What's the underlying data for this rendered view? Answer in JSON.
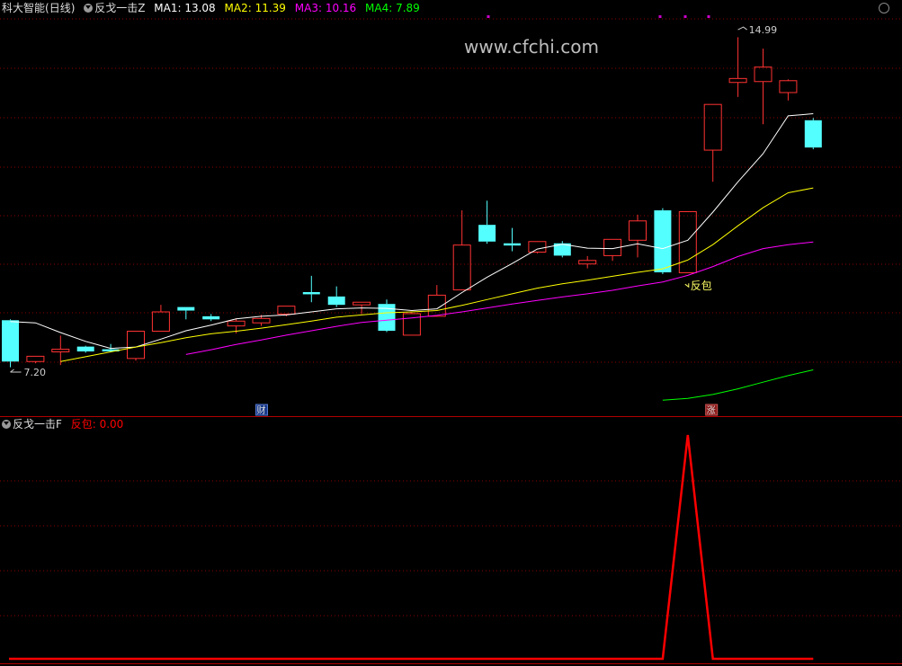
{
  "main_panel": {
    "stock_name": "科大智能",
    "period": "(日线)",
    "indicator_name": "反戈一击Z",
    "ma": [
      {
        "label": "MA1: 13.08",
        "color": "#ffffff"
      },
      {
        "label": "MA2: 11.39",
        "color": "#ffff00"
      },
      {
        "label": "MA3: 10.16",
        "color": "#ff00ff"
      },
      {
        "label": "MA4: 7.89",
        "color": "#00ff00"
      }
    ],
    "watermark": "www.cfchi.com",
    "high_label": "14.99",
    "low_label": "7.20",
    "signal_label": "反包",
    "marker_cai": "财",
    "marker_zhang": "涨"
  },
  "sub_panel": {
    "indicator_name": "反戈一击F",
    "value_label": "反包: 0.00"
  },
  "colors": {
    "up": "#ff3232",
    "down": "#54ffff",
    "ma1": "#ffffff",
    "ma2": "#ffff00",
    "ma3": "#ff00ff",
    "ma4": "#00ff00",
    "signal": "#ff0000",
    "grid": "#8b0000"
  },
  "chart_data": [
    {
      "type": "candlestick",
      "title": "科大智能 (日线)",
      "ylim": [
        6.3,
        15.5
      ],
      "candles": [
        {
          "o": 8.38,
          "h": 8.4,
          "l": 7.31,
          "c": 7.44
        },
        {
          "o": 7.44,
          "h": 7.56,
          "l": 7.4,
          "c": 7.56
        },
        {
          "o": 7.66,
          "h": 8.03,
          "l": 7.36,
          "c": 7.72
        },
        {
          "o": 7.78,
          "h": 7.8,
          "l": 7.64,
          "c": 7.67
        },
        {
          "o": 7.72,
          "h": 7.84,
          "l": 7.67,
          "c": 7.67
        },
        {
          "o": 7.51,
          "h": 8.12,
          "l": 7.46,
          "c": 8.13
        },
        {
          "o": 8.13,
          "h": 8.73,
          "l": 8.13,
          "c": 8.57
        },
        {
          "o": 8.68,
          "h": 8.68,
          "l": 8.4,
          "c": 8.6
        },
        {
          "o": 8.47,
          "h": 8.52,
          "l": 8.36,
          "c": 8.4
        },
        {
          "o": 8.25,
          "h": 8.42,
          "l": 8.08,
          "c": 8.36
        },
        {
          "o": 8.32,
          "h": 8.5,
          "l": 8.25,
          "c": 8.42
        },
        {
          "o": 8.52,
          "h": 8.7,
          "l": 8.47,
          "c": 8.7
        },
        {
          "o": 9.02,
          "h": 9.39,
          "l": 8.79,
          "c": 8.97
        },
        {
          "o": 8.92,
          "h": 9.15,
          "l": 8.68,
          "c": 8.73
        },
        {
          "o": 8.73,
          "h": 8.79,
          "l": 8.52,
          "c": 8.79
        },
        {
          "o": 8.75,
          "h": 8.85,
          "l": 8.11,
          "c": 8.14
        },
        {
          "o": 8.04,
          "h": 8.58,
          "l": 8.04,
          "c": 8.53
        },
        {
          "o": 8.47,
          "h": 9.18,
          "l": 8.47,
          "c": 8.95
        },
        {
          "o": 9.07,
          "h": 10.88,
          "l": 9.07,
          "c": 10.09
        },
        {
          "o": 10.55,
          "h": 11.1,
          "l": 10.12,
          "c": 10.17
        },
        {
          "o": 10.13,
          "h": 10.48,
          "l": 9.95,
          "c": 10.08
        },
        {
          "o": 9.93,
          "h": 10.17,
          "l": 9.9,
          "c": 10.17
        },
        {
          "o": 10.13,
          "h": 10.18,
          "l": 9.81,
          "c": 9.85
        },
        {
          "o": 9.66,
          "h": 9.84,
          "l": 9.56,
          "c": 9.74
        },
        {
          "o": 9.85,
          "h": 10.22,
          "l": 9.73,
          "c": 10.22
        },
        {
          "o": 10.2,
          "h": 10.78,
          "l": 9.81,
          "c": 10.64
        },
        {
          "o": 10.88,
          "h": 10.93,
          "l": 9.43,
          "c": 9.47
        },
        {
          "o": 9.46,
          "h": 10.85,
          "l": 9.46,
          "c": 10.85
        },
        {
          "o": 12.25,
          "h": 13.29,
          "l": 11.53,
          "c": 13.29
        },
        {
          "o": 13.79,
          "h": 14.82,
          "l": 13.46,
          "c": 13.88
        },
        {
          "o": 13.81,
          "h": 14.56,
          "l": 12.84,
          "c": 14.14
        },
        {
          "o": 13.56,
          "h": 13.86,
          "l": 13.38,
          "c": 13.83
        },
        {
          "o": 12.93,
          "h": 12.98,
          "l": 12.27,
          "c": 12.31
        }
      ],
      "series": [
        {
          "name": "MA1",
          "values": [
            8.35,
            8.32,
            8.1,
            7.9,
            7.74,
            7.77,
            7.95,
            8.14,
            8.27,
            8.41,
            8.47,
            8.5,
            8.57,
            8.64,
            8.66,
            8.65,
            8.6,
            8.64,
            9.01,
            9.36,
            9.67,
            10.0,
            10.11,
            10.02,
            10.01,
            10.12,
            10.01,
            10.2,
            10.84,
            11.53,
            12.17,
            13.03,
            13.08
          ]
        },
        {
          "name": "MA2",
          "values": [
            null,
            null,
            7.44,
            7.55,
            7.66,
            7.77,
            7.87,
            7.98,
            8.07,
            8.13,
            8.2,
            8.28,
            8.36,
            8.45,
            8.5,
            8.55,
            8.57,
            8.6,
            8.72,
            8.85,
            8.98,
            9.11,
            9.21,
            9.29,
            9.38,
            9.47,
            9.55,
            9.75,
            10.1,
            10.53,
            10.94,
            11.28,
            11.39
          ]
        },
        {
          "name": "MA3",
          "values": [
            null,
            null,
            null,
            null,
            null,
            null,
            null,
            7.6,
            7.71,
            7.83,
            7.93,
            8.04,
            8.14,
            8.24,
            8.33,
            8.38,
            8.43,
            8.49,
            8.57,
            8.66,
            8.75,
            8.83,
            8.91,
            8.98,
            9.06,
            9.16,
            9.25,
            9.4,
            9.6,
            9.83,
            10.01,
            10.1,
            10.16
          ]
        },
        {
          "name": "MA4",
          "values": [
            null,
            null,
            null,
            null,
            null,
            null,
            null,
            null,
            null,
            null,
            null,
            null,
            null,
            null,
            null,
            null,
            null,
            null,
            null,
            null,
            null,
            null,
            null,
            null,
            null,
            null,
            6.56,
            6.6,
            6.69,
            6.82,
            6.97,
            7.12,
            7.25
          ]
        }
      ],
      "annotations": [
        {
          "text": "14.99",
          "index": 29,
          "value": 14.99
        },
        {
          "text": "7.20",
          "index": 0,
          "value": 7.2
        },
        {
          "text": "反包",
          "index": 27,
          "value": 9.2
        },
        {
          "text": "财",
          "index": 10
        },
        {
          "text": "涨",
          "index": 28
        }
      ],
      "grid": true
    },
    {
      "type": "line",
      "title": "反戈一击F",
      "ylim": [
        0,
        1
      ],
      "series": [
        {
          "name": "反包",
          "values": [
            0,
            0,
            0,
            0,
            0,
            0,
            0,
            0,
            0,
            0,
            0,
            0,
            0,
            0,
            0,
            0,
            0,
            0,
            0,
            0,
            0,
            0,
            0,
            0,
            0,
            0,
            0,
            1,
            0,
            0,
            0,
            0,
            0
          ]
        }
      ],
      "grid": true
    }
  ]
}
